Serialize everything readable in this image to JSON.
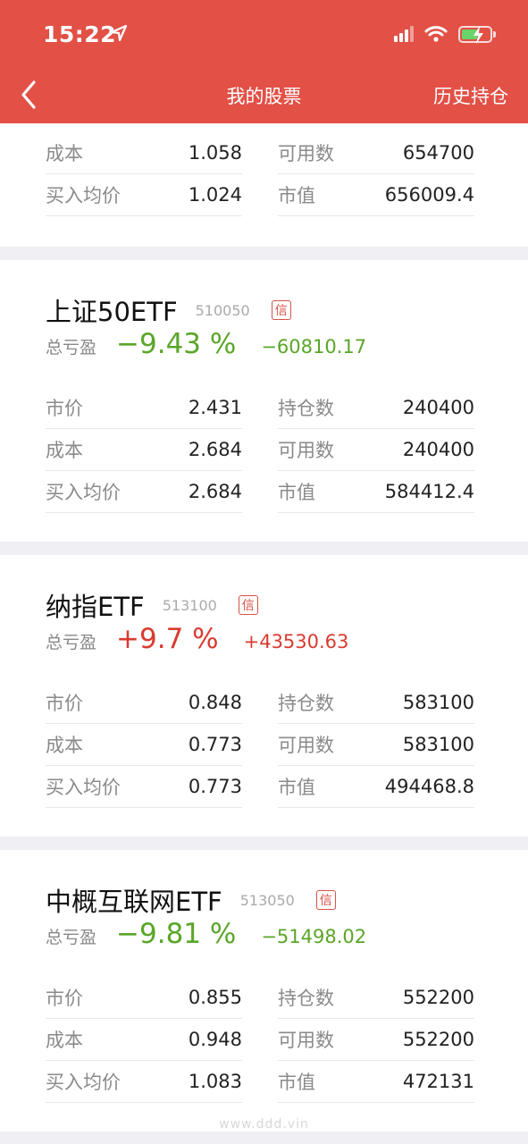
{
  "status": {
    "time": "15:22"
  },
  "nav": {
    "title": "我的股票",
    "right": "历史持仓"
  },
  "top_card": {
    "rows_left": [
      {
        "k": "成本",
        "v": "1.058"
      },
      {
        "k": "买入均价",
        "v": "1.024"
      }
    ],
    "rows_right": [
      {
        "k": "可用数",
        "v": "654700"
      },
      {
        "k": "市值",
        "v": "656009.4"
      }
    ]
  },
  "stocks": [
    {
      "name": "上证50ETF",
      "code": "510050",
      "badge": "信",
      "pl_label": "总亏盈",
      "pl_pct": "−9.43 %",
      "pl_amt": "−60810.17",
      "trend": "down",
      "left": [
        {
          "k": "市价",
          "v": "2.431"
        },
        {
          "k": "成本",
          "v": "2.684"
        },
        {
          "k": "买入均价",
          "v": "2.684"
        }
      ],
      "right": [
        {
          "k": "持仓数",
          "v": "240400"
        },
        {
          "k": "可用数",
          "v": "240400"
        },
        {
          "k": "市值",
          "v": "584412.4"
        }
      ]
    },
    {
      "name": "纳指ETF",
      "code": "513100",
      "badge": "信",
      "pl_label": "总亏盈",
      "pl_pct": "+9.7 %",
      "pl_amt": "+43530.63",
      "trend": "up",
      "left": [
        {
          "k": "市价",
          "v": "0.848"
        },
        {
          "k": "成本",
          "v": "0.773"
        },
        {
          "k": "买入均价",
          "v": "0.773"
        }
      ],
      "right": [
        {
          "k": "持仓数",
          "v": "583100"
        },
        {
          "k": "可用数",
          "v": "583100"
        },
        {
          "k": "市值",
          "v": "494468.8"
        }
      ]
    },
    {
      "name": "中概互联网ETF",
      "code": "513050",
      "badge": "信",
      "pl_label": "总亏盈",
      "pl_pct": "−9.81 %",
      "pl_amt": "−51498.02",
      "trend": "down",
      "left": [
        {
          "k": "市价",
          "v": "0.855"
        },
        {
          "k": "成本",
          "v": "0.948"
        },
        {
          "k": "买入均价",
          "v": "1.083"
        }
      ],
      "right": [
        {
          "k": "持仓数",
          "v": "552200"
        },
        {
          "k": "可用数",
          "v": "552200"
        },
        {
          "k": "市值",
          "v": "472131"
        }
      ]
    }
  ],
  "watermark": "www.ddd.vin",
  "colors": {
    "header": "#e25046",
    "down": "#5aa629",
    "up": "#d93b30"
  }
}
